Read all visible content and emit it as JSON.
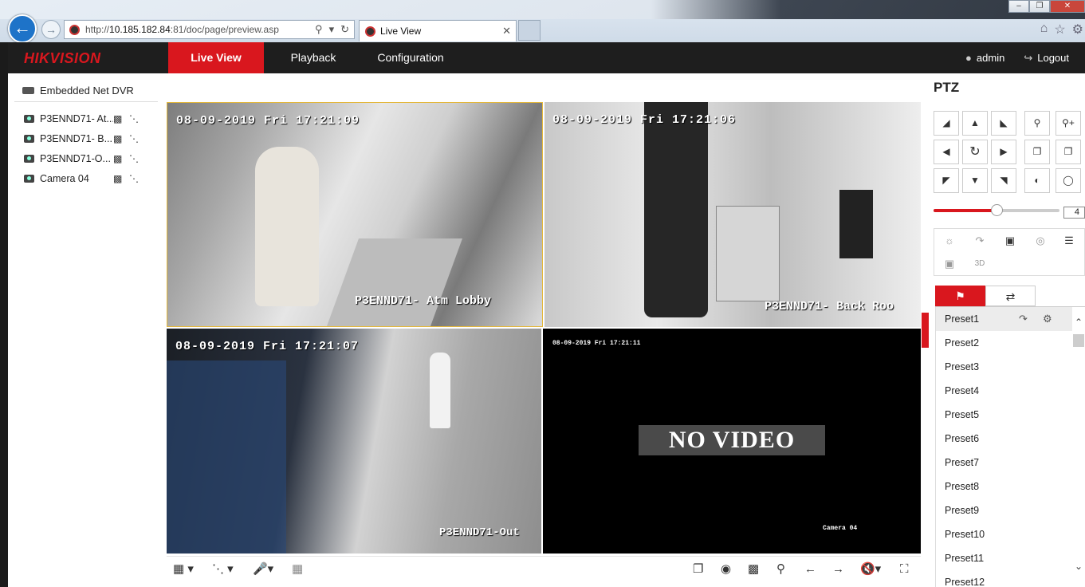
{
  "browser": {
    "url_prefix": "http://",
    "url_host": "10.185.182.84",
    "url_rest": ":81/doc/page/preview.asp",
    "tab_title": "Live View"
  },
  "app": {
    "brand": "HIKVISION",
    "nav": [
      {
        "label": "Live View",
        "active": true
      },
      {
        "label": "Playback",
        "active": false
      },
      {
        "label": "Configuration",
        "active": false
      }
    ],
    "user": "admin",
    "logout": "Logout"
  },
  "tree": {
    "root": "Embedded Net DVR",
    "cameras": [
      {
        "name": "P3ENND71- At..."
      },
      {
        "name": "P3ENND71- B..."
      },
      {
        "name": "P3ENND71-O..."
      },
      {
        "name": "Camera 04"
      }
    ]
  },
  "video": {
    "tiles": [
      {
        "timestamp": "08-09-2019 Fri 17:21:09",
        "camera_label": "P3ENND71- Atm Lobby"
      },
      {
        "timestamp": "08-09-2019 Fri 17:21:06",
        "camera_label": "P3ENND71- Back Roo"
      },
      {
        "timestamp": "08-09-2019 Fri 17:21:07",
        "camera_label": "P3ENND71-Out"
      },
      {
        "timestamp": "08-09-2019 Fri 17:21:11",
        "camera_label": "Camera 04",
        "status": "NO VIDEO"
      }
    ]
  },
  "ptz": {
    "title": "PTZ",
    "speed": 4,
    "speed_fraction": 0.5,
    "presets": [
      "Preset1",
      "Preset2",
      "Preset3",
      "Preset4",
      "Preset5",
      "Preset6",
      "Preset7",
      "Preset8",
      "Preset9",
      "Preset10",
      "Preset11",
      "Preset12"
    ]
  },
  "colors": {
    "brand_red": "#d9171e",
    "header_bg": "#1e1e1e",
    "selection_border": "#e3b73b"
  }
}
